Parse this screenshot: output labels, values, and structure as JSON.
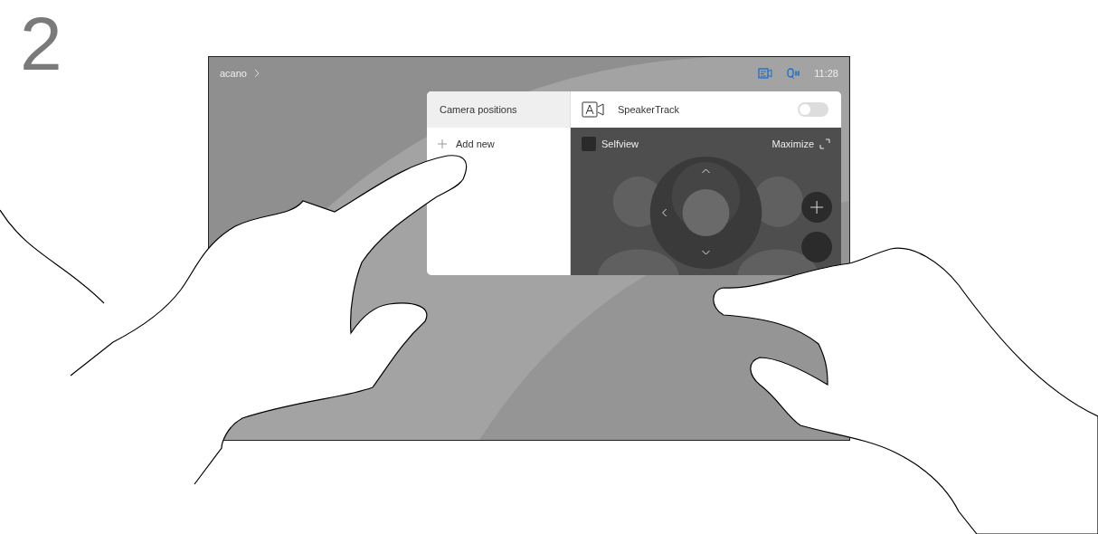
{
  "step": "2",
  "status_bar": {
    "breadcrumb": "acano",
    "time": "11:28"
  },
  "panel": {
    "title": "Camera positions",
    "add_label": "Add new",
    "speakertrack": {
      "label": "SpeakerTrack",
      "on": false
    },
    "selfview": "Selfview",
    "maximize": "Maximize"
  }
}
